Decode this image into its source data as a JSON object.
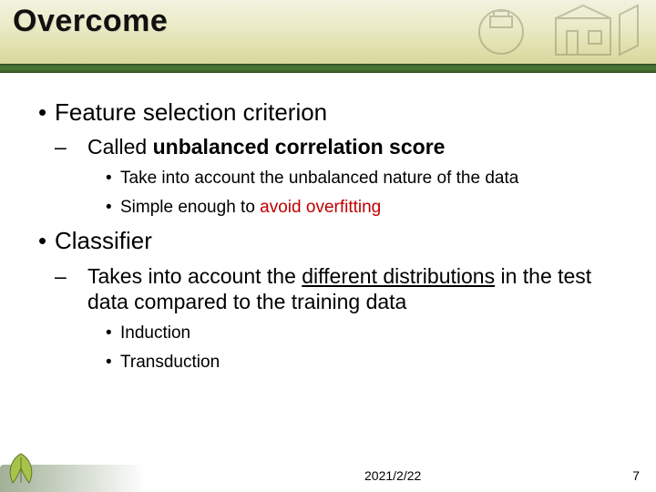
{
  "slide": {
    "title": "Overcome",
    "bullets": {
      "b1": "Feature selection criterion",
      "b1_1_pre": "Called ",
      "b1_1_bold": "unbalanced correlation score",
      "b1_1a": "Take into account the unbalanced nature of the data",
      "b1_1b_pre": "Simple enough to ",
      "b1_1b_red": "avoid overfitting",
      "b2": "Classifier",
      "b2_1_pre": "Takes into account the ",
      "b2_1_ul": "different distributions",
      "b2_1_post": " in the test data compared to the training data",
      "b2_1a": "Induction",
      "b2_1b": "Transduction"
    },
    "date": "2021/2/22",
    "page": "7"
  }
}
